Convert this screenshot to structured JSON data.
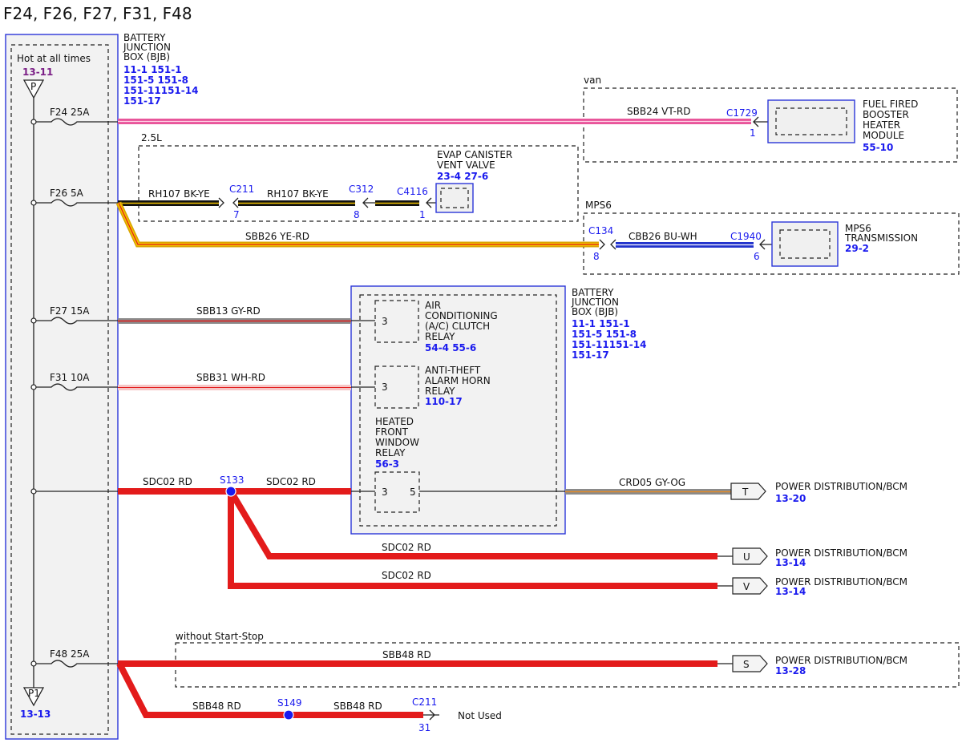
{
  "title": "F24, F26, F27, F31, F48",
  "bjb": {
    "label_lines": [
      "BATTERY",
      "JUNCTION",
      "BOX (BJB)"
    ],
    "ref_lines": [
      "11-1   151-1",
      "151-5 151-8",
      "151-11151-14",
      "151-17"
    ],
    "hot_label": "Hot at all times",
    "hot_ref": "13-11",
    "top_conn": "P",
    "bottom_conn": "P1",
    "bottom_ref": "13-13"
  },
  "fuses": {
    "f24": "F24  25A",
    "f26": "F26  5A",
    "f27": "F27  15A",
    "f31": "F31  10A",
    "f48": "F48  25A"
  },
  "van": {
    "group_label": "van",
    "wire": "SBB24  VT-RD",
    "conn": "C1729",
    "pin": "1",
    "module_lines": [
      "FUEL FIRED",
      "BOOSTER",
      "HEATER",
      "MODULE"
    ],
    "module_ref": "55-10"
  },
  "evap": {
    "group_label": "2.5L",
    "wire1": "RH107  BK-YE",
    "wire2": "RH107  BK-YE",
    "conn1": "C211",
    "pin1": "7",
    "conn2": "C312",
    "pin2": "8",
    "conn3": "C4116",
    "pin3": "1",
    "device_lines": [
      "EVAP CANISTER",
      "VENT VALVE"
    ],
    "device_ref": "23-4   27-6"
  },
  "mps6": {
    "group_label": "MPS6",
    "wire1": "SBB26  YE-RD",
    "conn1": "C134",
    "pin1": "8",
    "wire2": "CBB26  BU-WH",
    "conn2": "C1940",
    "pin2": "6",
    "module_lines": [
      "MPS6",
      "TRANSMISSION"
    ],
    "module_ref": "29-2"
  },
  "bjb2": {
    "label_lines": [
      "BATTERY",
      "JUNCTION",
      "BOX (BJB)"
    ],
    "ref_lines": [
      "11-1   151-1",
      "151-5 151-8",
      "151-11151-14",
      "151-17"
    ]
  },
  "relays": {
    "ac_lines": [
      "AIR",
      "CONDITIONING",
      "(A/C) CLUTCH",
      "RELAY"
    ],
    "ac_ref": "54-4   55-6",
    "ac_pin": "3",
    "horn_lines": [
      "ANTI-THEFT",
      "ALARM HORN",
      "RELAY"
    ],
    "horn_ref": "110-17",
    "horn_pin": "3",
    "hfw_lines": [
      "HEATED",
      "FRONT",
      "WINDOW",
      "RELAY"
    ],
    "hfw_ref": "56-3",
    "hfw_pin_in": "3",
    "hfw_pin_out": "5"
  },
  "wires": {
    "sbb13": "SBB13  GY-RD",
    "sbb31": "SBB31  WH-RD",
    "sdc02_a": "SDC02  RD",
    "sdc02_b": "SDC02  RD",
    "sdc02_c": "SDC02  RD",
    "sdc02_d": "SDC02  RD",
    "crd05": "CRD05  GY-OG",
    "sbb48_a": "SBB48  RD",
    "sbb48_b": "SBB48  RD",
    "sbb48_c": "SBB48  RD"
  },
  "splices": {
    "s133": "S133",
    "s149": "S149"
  },
  "outputs": {
    "t_conn": "T",
    "t_label": "POWER DISTRIBUTION/BCM",
    "t_ref": "13-20",
    "u_conn": "U",
    "u_label": "POWER DISTRIBUTION/BCM",
    "u_ref": "13-14",
    "v_conn": "V",
    "v_label": "POWER DISTRIBUTION/BCM",
    "v_ref": "13-14",
    "s_conn": "S",
    "s_label": "POWER DISTRIBUTION/BCM",
    "s_ref": "13-28"
  },
  "start_stop": {
    "group_label": "without Start-Stop"
  },
  "not_used": {
    "conn": "C211",
    "pin": "31",
    "label": "Not Used"
  },
  "colors": {
    "box_border": "#2a35d8",
    "reference_blue": "#1a1aee",
    "reference_purple": "#7b1f86",
    "wire_red": "#e31b1b",
    "wire_violet_red": "#e8559a",
    "wire_yellow": "#f2c200",
    "wire_blue": "#2233cc"
  }
}
